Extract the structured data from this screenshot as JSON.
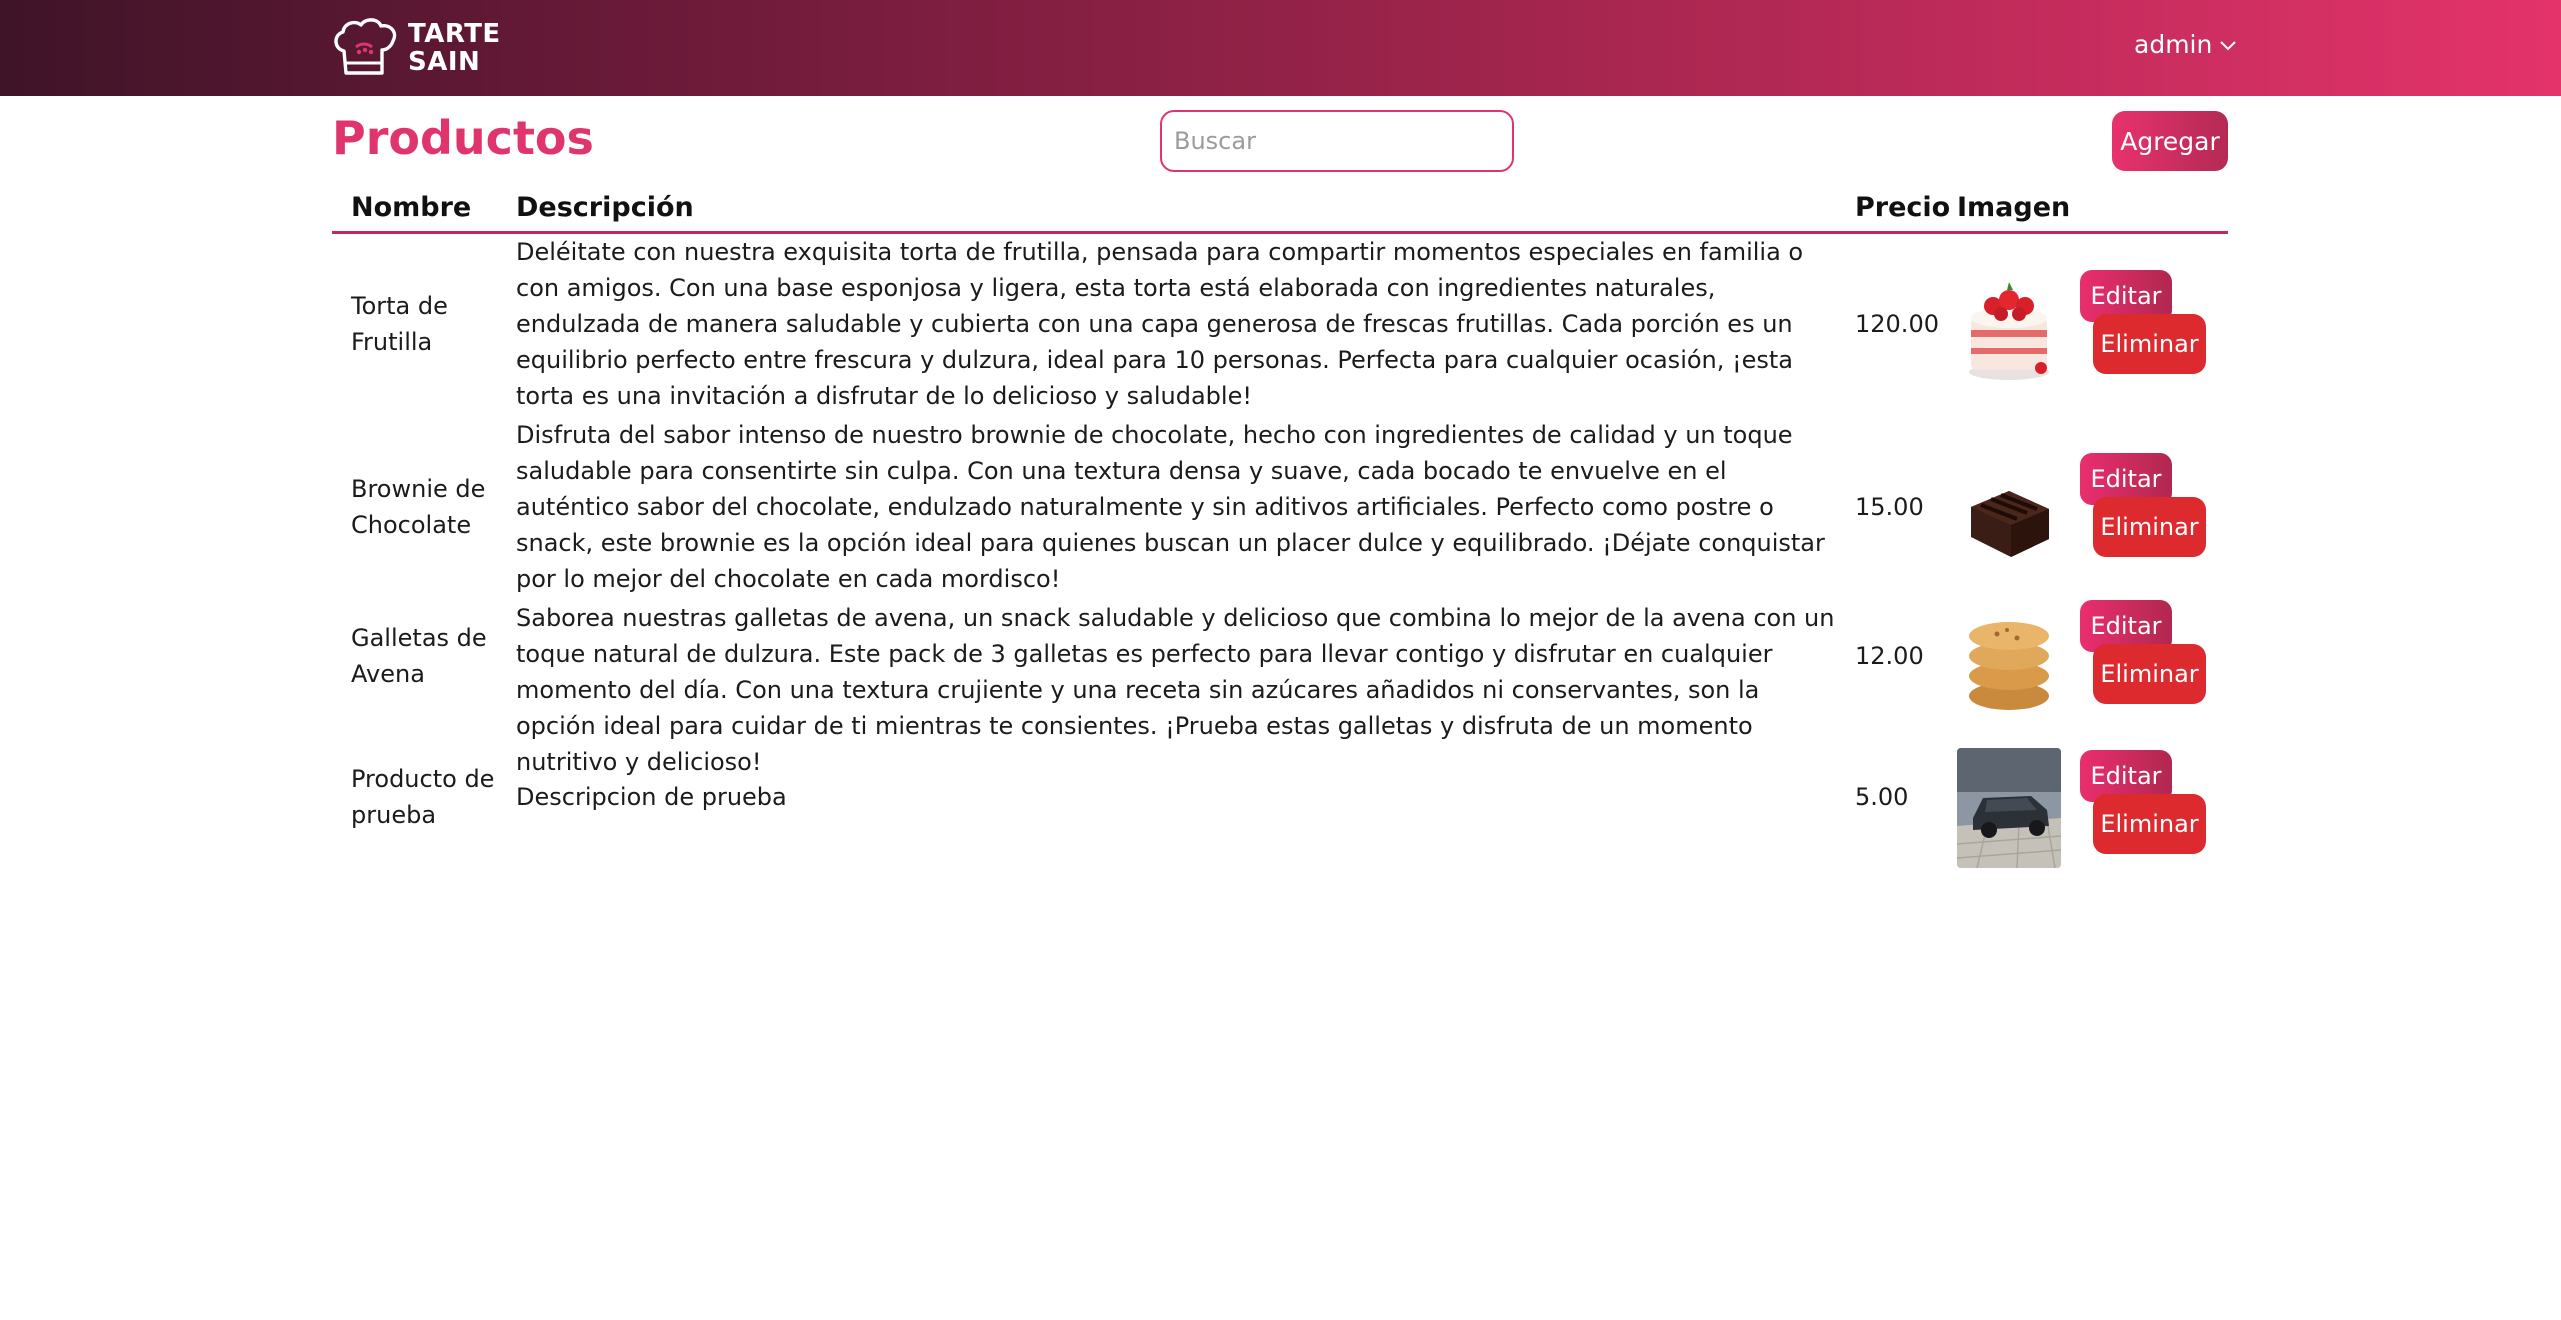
{
  "header": {
    "brand_line1": "TARTE",
    "brand_line2": "SAIN",
    "user_label": "admin"
  },
  "toolbar": {
    "title": "Productos",
    "search_placeholder": "Buscar",
    "add_label": "Agregar"
  },
  "table": {
    "columns": {
      "name": "Nombre",
      "description": "Descripción",
      "price": "Precio",
      "image": "Imagen"
    },
    "rows": [
      {
        "name": "Torta de Frutilla",
        "description": "Deléitate con nuestra exquisita torta de frutilla, pensada para compartir momentos especiales en familia o con amigos. Con una base esponjosa y ligera, esta torta está elaborada con ingredientes naturales, endulzada de manera saludable y cubierta con una capa generosa de frescas frutillas. Cada porción es un equilibrio perfecto entre frescura y dulzura, ideal para 10 personas. Perfecta para cualquier ocasión, ¡esta torta es una invitación a disfrutar de lo delicioso y saludable!",
        "price": "120.00",
        "image_icon": "strawberry-cake-image",
        "edit_label": "Editar",
        "delete_label": "Eliminar"
      },
      {
        "name": "Brownie de Chocolate",
        "description": "Disfruta del sabor intenso de nuestro brownie de chocolate, hecho con ingredientes de calidad y un toque saludable para consentirte sin culpa. Con una textura densa y suave, cada bocado te envuelve en el auténtico sabor del chocolate, endulzado naturalmente y sin aditivos artificiales. Perfecto como postre o snack, este brownie es la opción ideal para quienes buscan un placer dulce y equilibrado. ¡Déjate conquistar por lo mejor del chocolate en cada mordisco!",
        "price": "15.00",
        "image_icon": "brownie-image",
        "edit_label": "Editar",
        "delete_label": "Eliminar"
      },
      {
        "name": "Galletas de Avena",
        "description": "Saborea nuestras galletas de avena, un snack saludable y delicioso que combina lo mejor de la avena con un toque natural de dulzura. Este pack de 3 galletas es perfecto para llevar contigo y disfrutar en cualquier momento del día. Con una textura crujiente y una receta sin azúcares añadidos ni conservantes, son la opción ideal para cuidar de ti mientras te consientes. ¡Prueba estas galletas y disfruta de un momento nutritivo y delicioso!",
        "price": "12.00",
        "image_icon": "oat-cookies-image",
        "edit_label": "Editar",
        "delete_label": "Eliminar"
      },
      {
        "name": "Producto de prueba",
        "description": "Descripcion de prueba",
        "price": "5.00",
        "image_icon": "car-photo-image",
        "edit_label": "Editar",
        "delete_label": "Eliminar"
      }
    ]
  },
  "colors": {
    "accent": "#e0356c",
    "header_start": "#3f1428",
    "header_end": "#e4336b",
    "delete": "#dd2a2e"
  }
}
